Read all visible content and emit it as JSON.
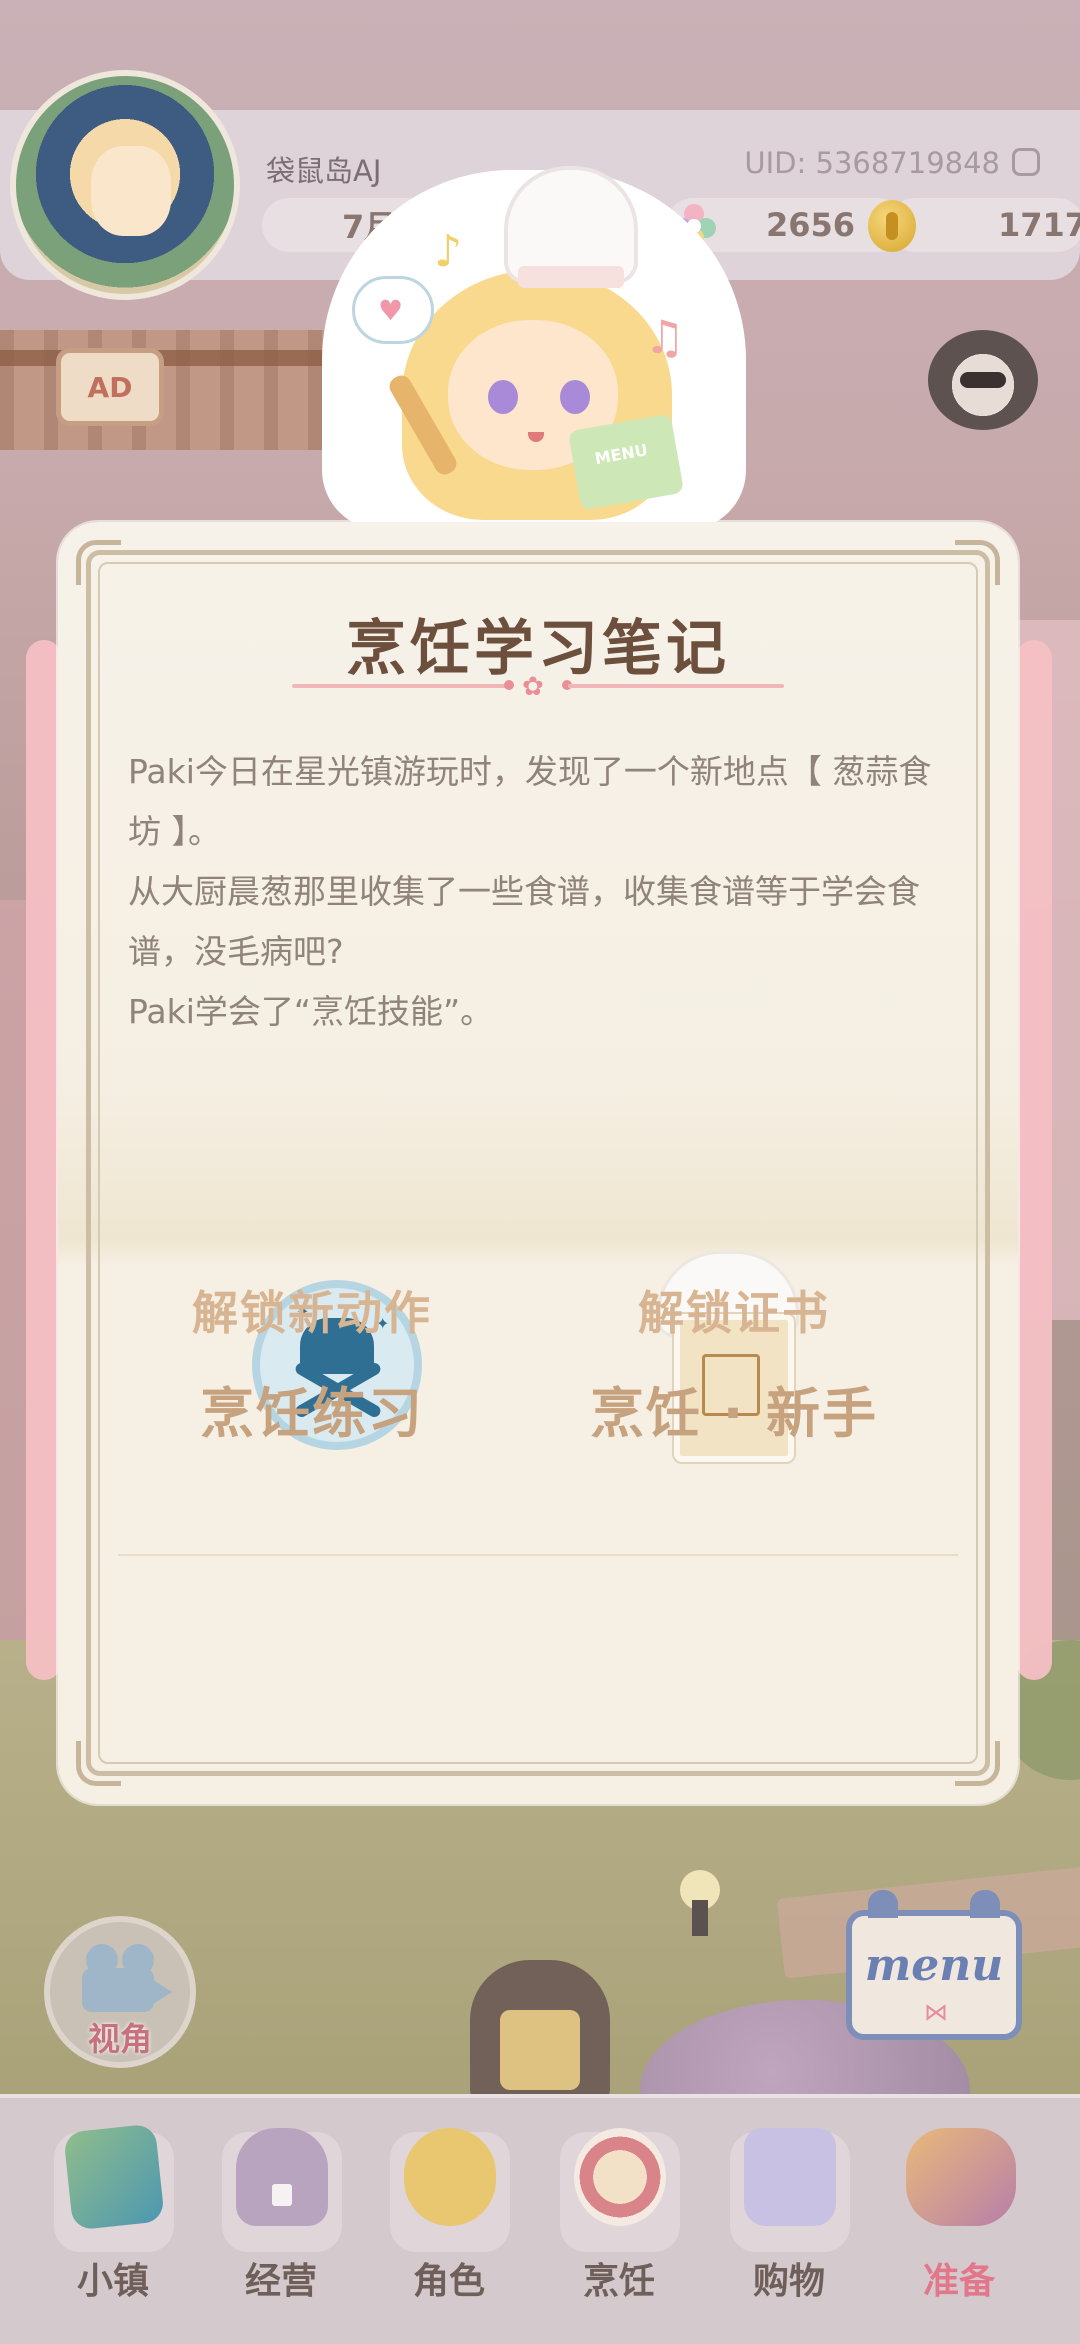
{
  "profile": {
    "nickname": "袋鼠岛AJ",
    "uid": "UID: 5368719848",
    "date": "7月11日",
    "gems": "2656",
    "coins": "1717"
  },
  "badges": {
    "ad": "AD"
  },
  "dialog": {
    "title": "烹饪学习笔记",
    "paragraphs": [
      "Paki今日在星光镇游玩时，发现了一个新地点【 葱蒜食坊 】。",
      "从大厨晨葱那里收集了一些食谱，收集食谱等于学会食谱，没毛病吧?",
      "Paki学会了“烹饪技能”。"
    ],
    "rewards": [
      {
        "label": "解锁新动作",
        "value": "烹饪练习",
        "icon": "chef-skill-icon"
      },
      {
        "label": "解锁证书",
        "value": "烹饪 · 新手",
        "icon": "certificate-icon"
      }
    ]
  },
  "sticker": {
    "book_text": "MENU"
  },
  "camera": {
    "label": "视角"
  },
  "menu_book": {
    "label": "menu"
  },
  "nav": {
    "items": [
      {
        "label": "小镇",
        "icon": "map-icon"
      },
      {
        "label": "经营",
        "icon": "hat-locked-icon"
      },
      {
        "label": "角色",
        "icon": "character-icon"
      },
      {
        "label": "烹饪",
        "icon": "sandwich-icon"
      },
      {
        "label": "购物",
        "icon": "shopping-bag-icon"
      },
      {
        "label": "准备",
        "icon": "prepare-basket-icon"
      }
    ],
    "active_index": 5
  },
  "colors": {
    "card_bg": "#f6efe3",
    "title": "#6c4f3c",
    "reward_text": "#c7a27f",
    "active_nav": "#e2768a"
  }
}
